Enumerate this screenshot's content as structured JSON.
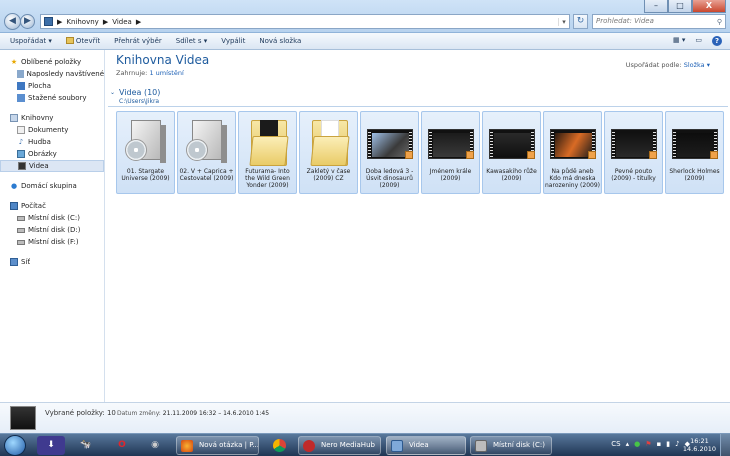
{
  "address": {
    "crumbs": [
      "Knihovny",
      "Videa"
    ],
    "search_placeholder": "Prohledat: Videa"
  },
  "window_controls": {
    "minimize": "–",
    "maximize": "□",
    "close": "X"
  },
  "toolbar": {
    "organize": "Uspořádat ▾",
    "open": "Otevřít",
    "playlist": "Přehrát výběr",
    "share": "Sdílet s ▾",
    "burn": "Vypálit",
    "new_folder": "Nová složka"
  },
  "sidebar": {
    "favorites": "Oblíbené položky",
    "recent": "Naposledy navštívené",
    "desktop": "Plocha",
    "downloads": "Stažené soubory",
    "libraries": "Knihovny",
    "documents": "Dokumenty",
    "music": "Hudba",
    "pictures": "Obrázky",
    "videos": "Videa",
    "homegroup": "Domácí skupina",
    "computer": "Počítač",
    "disk_c": "Místní disk (C:)",
    "disk_d": "Místní disk (D:)",
    "disk_f": "Místní disk (F:)",
    "network": "Síť"
  },
  "library": {
    "title": "Knihovna Videa",
    "includes_label": "Zahrnuje:",
    "includes_link": "1 umístění",
    "arrange_label": "Uspořádat podle:",
    "arrange_value": "Složka ▾",
    "group_title": "Videa (10)",
    "group_path": "C:\\Users\\Jikra"
  },
  "files": [
    {
      "name": "01. Stargate Universe (2009)",
      "kind": "box"
    },
    {
      "name": "02. V + Caprica + Cestovatel (2009)",
      "kind": "box"
    },
    {
      "name": "Futurama- Into the Wild Green Yonder (2009)",
      "kind": "folder-dark"
    },
    {
      "name": "Zakletý v čase (2009) CZ",
      "kind": "folder-light"
    },
    {
      "name": "Doba ledová 3 - Úsvit dinosaurů (2009)",
      "kind": "video"
    },
    {
      "name": "Jménem krále (2009)",
      "kind": "video"
    },
    {
      "name": "Kawasakiho růže (2009)",
      "kind": "video"
    },
    {
      "name": "Na půdě aneb Kdo má dneska narozeniny (2009)",
      "kind": "video"
    },
    {
      "name": "Pevné pouto (2009) - titulky",
      "kind": "video"
    },
    {
      "name": "Sherlock Holmes (2009)",
      "kind": "video"
    }
  ],
  "details": {
    "selected": "Vybrané položky: 10",
    "date_label": "Datum změny:",
    "date_value": "21.11.2009 16:32 – 14.6.2010 1:45"
  },
  "taskbar": {
    "tasks": [
      "Nová otázka | P...",
      "Nero MediaHub",
      "Videa",
      "Místní disk (C:)"
    ],
    "lang": "CS",
    "time": "16:21",
    "date": "14.6.2010"
  }
}
